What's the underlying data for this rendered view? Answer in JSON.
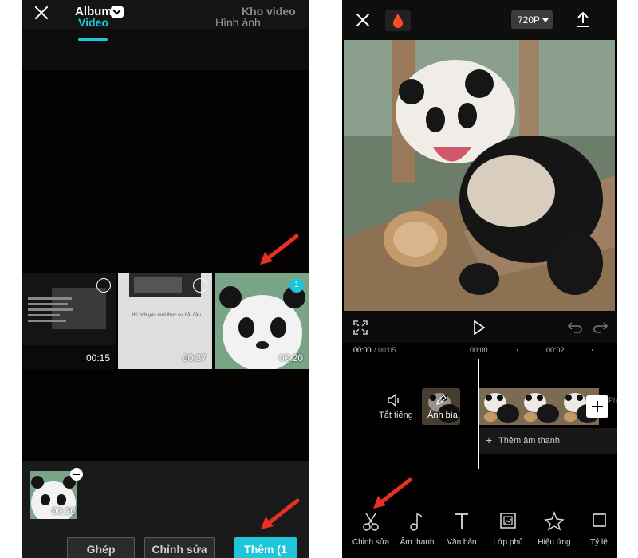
{
  "left_screen": {
    "header": {
      "title": "Album",
      "right_link": "Kho video"
    },
    "tabs": [
      {
        "label": "Video",
        "active": true
      },
      {
        "label": "Hình ảnh",
        "active": false
      }
    ],
    "thumbnails": [
      {
        "duration": "00:15",
        "selected": false,
        "caption": "thì tình yêu mới thực sự bắt đầu"
      },
      {
        "duration": "00:37",
        "selected": false,
        "caption": "thì tình yêu mới thực sự bắt đầu"
      },
      {
        "duration": "00:20",
        "selected": true,
        "index": "1"
      }
    ],
    "selected_item": {
      "duration": "00:20"
    },
    "buttons": {
      "merge": "Ghép",
      "edit": "Chỉnh sửa",
      "add": "Thêm (1"
    }
  },
  "right_screen": {
    "resolution": "720P",
    "timeline": {
      "current": "00:00",
      "total": "/ 00:05",
      "tick_1": "00:00",
      "tick_2": "00:02"
    },
    "mute_label": "Tắt tiếng",
    "cover_label": "Ảnh bìa",
    "overflow_label": "Phầ",
    "add_audio_label": "Thêm âm thanh",
    "toolbar": [
      {
        "label": "Chỉnh sửa",
        "icon": "scissors-icon"
      },
      {
        "label": "Âm thanh",
        "icon": "music-note-icon"
      },
      {
        "label": "Văn bản",
        "icon": "text-icon"
      },
      {
        "label": "Lớp phủ",
        "icon": "overlay-icon"
      },
      {
        "label": "Hiệu ứng",
        "icon": "effects-star-icon"
      },
      {
        "label": "Tỷ lệ",
        "icon": "ratio-square-icon"
      }
    ]
  },
  "colors": {
    "accent": "#1fc6d9",
    "arrow": "#e53025",
    "background": "#000000"
  }
}
